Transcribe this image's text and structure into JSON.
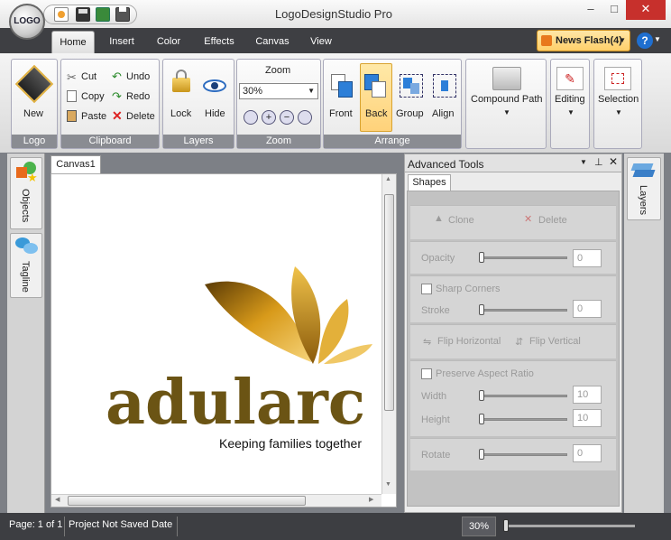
{
  "app": {
    "title": "LogoDesignStudio Pro",
    "logo_text": "LOGO"
  },
  "window": {
    "minimize": "–",
    "maximize": "□",
    "close": "✕"
  },
  "tabs": [
    "Home",
    "Insert",
    "Color",
    "Effects",
    "Canvas",
    "View"
  ],
  "news_flash": "News Flash(4)",
  "ribbon": {
    "logo": {
      "new_label": "New",
      "caption": "Logo"
    },
    "clipboard": {
      "cut": "Cut",
      "copy": "Copy",
      "paste": "Paste",
      "undo": "Undo",
      "redo": "Redo",
      "delete": "Delete",
      "caption": "Clipboard"
    },
    "layers": {
      "lock": "Lock",
      "hide": "Hide",
      "caption": "Layers"
    },
    "zoom": {
      "title": "Zoom",
      "value": "30%",
      "caption": "Zoom"
    },
    "arrange": {
      "front": "Front",
      "back": "Back",
      "group": "Group",
      "align": "Align",
      "caption": "Arrange"
    },
    "compound": {
      "label": "Compound Path"
    },
    "editing": {
      "label": "Editing"
    },
    "selection": {
      "label": "Selection"
    }
  },
  "side_tabs": {
    "objects": "Objects",
    "tagline": "Tagline",
    "layers": "Layers"
  },
  "canvas": {
    "tab": "Canvas1",
    "logo_word": "adularc",
    "tagline": "Keeping families together"
  },
  "advanced": {
    "title": "Advanced Tools",
    "tab": "Shapes",
    "clone": "Clone",
    "delete": "Delete",
    "opacity": {
      "label": "Opacity",
      "value": "0"
    },
    "sharp_corners": "Sharp Corners",
    "stroke": {
      "label": "Stroke",
      "value": "0"
    },
    "flip_h": "Flip Horizontal",
    "flip_v": "Flip Vertical",
    "preserve": "Preserve Aspect Ratio",
    "width": {
      "label": "Width",
      "value": "10"
    },
    "height": {
      "label": "Height",
      "value": "10"
    },
    "rotate": {
      "label": "Rotate",
      "value": "0"
    }
  },
  "status": {
    "page": "Page: 1 of 1",
    "project": "Project Not Saved",
    "date": "Date",
    "zoom": "30%"
  },
  "colors": {
    "accent": "#f0a030",
    "titlebar": "#e9e9e9",
    "dark": "#3e3f43",
    "leaf": "#d9a21b",
    "logo_text": "#6b5414"
  }
}
